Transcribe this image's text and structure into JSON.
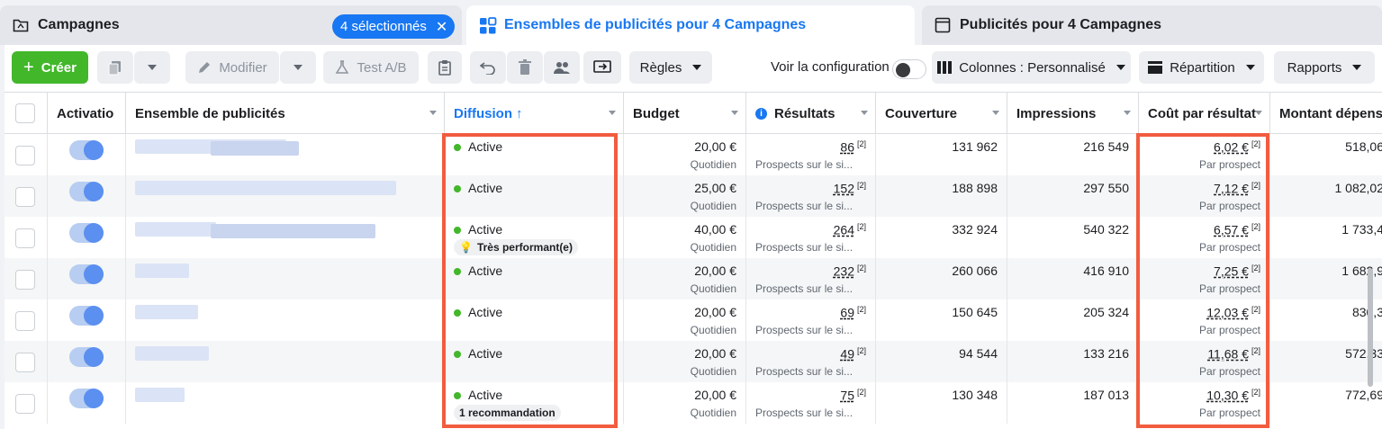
{
  "tabs": {
    "campaigns": "Campagnes",
    "selected_badge": "4 sélectionnés",
    "adsets": "Ensembles de publicités pour 4 Campagnes",
    "ads": "Publicités pour 4 Campagnes"
  },
  "toolbar": {
    "create": "Créer",
    "modify": "Modifier",
    "abtest": "Test A/B",
    "rules": "Règles",
    "view_config": "Voir la configuration",
    "columns": "Colonnes : Personnalisé",
    "breakdown": "Répartition",
    "reports": "Rapports"
  },
  "columns": {
    "activation": "Activatio",
    "adset": "Ensemble de publicités",
    "delivery": "Diffusion",
    "budget": "Budget",
    "results": "Résultats",
    "reach": "Couverture",
    "impressions": "Impressions",
    "cost": "Coût par résultat",
    "spent": "Montant dépensé"
  },
  "rows": [
    {
      "status": "Active",
      "badge": "",
      "budget": "20,00 €",
      "budget_sub": "Quotidien",
      "results": "86",
      "results_sub": "Prospects sur le si...",
      "reach": "131 962",
      "impressions": "216 549",
      "cost": "6,02 €",
      "cost_sub": "Par prospect",
      "spent": "518,06"
    },
    {
      "status": "Active",
      "badge": "",
      "budget": "25,00 €",
      "budget_sub": "Quotidien",
      "results": "152",
      "results_sub": "Prospects sur le si...",
      "reach": "188 898",
      "impressions": "297 550",
      "cost": "7,12 €",
      "cost_sub": "Par prospect",
      "spent": "1 082,02"
    },
    {
      "status": "Active",
      "badge": "Très performant(e)",
      "budget": "40,00 €",
      "budget_sub": "Quotidien",
      "results": "264",
      "results_sub": "Prospects sur le si...",
      "reach": "332 924",
      "impressions": "540 322",
      "cost": "6,57 €",
      "cost_sub": "Par prospect",
      "spent": "1 733,4"
    },
    {
      "status": "Active",
      "badge": "",
      "budget": "20,00 €",
      "budget_sub": "Quotidien",
      "results": "232",
      "results_sub": "Prospects sur le si...",
      "reach": "260 066",
      "impressions": "416 910",
      "cost": "7,25 €",
      "cost_sub": "Par prospect",
      "spent": "1 682,9"
    },
    {
      "status": "Active",
      "badge": "",
      "budget": "20,00 €",
      "budget_sub": "Quotidien",
      "results": "69",
      "results_sub": "Prospects sur le si...",
      "reach": "150 645",
      "impressions": "205 324",
      "cost": "12,03 €",
      "cost_sub": "Par prospect",
      "spent": "830,3"
    },
    {
      "status": "Active",
      "badge": "",
      "budget": "20,00 €",
      "budget_sub": "Quotidien",
      "results": "49",
      "results_sub": "Prospects sur le si...",
      "reach": "94 544",
      "impressions": "133 216",
      "cost": "11,68 €",
      "cost_sub": "Par prospect",
      "spent": "572,33"
    },
    {
      "status": "Active",
      "badge": "1 recommandation",
      "budget": "20,00 €",
      "budget_sub": "Quotidien",
      "results": "75",
      "results_sub": "Prospects sur le si...",
      "reach": "130 348",
      "impressions": "187 013",
      "cost": "10,30 €",
      "cost_sub": "Par prospect",
      "spent": "772,69"
    }
  ],
  "result_footnote": "[2]",
  "colors": {
    "accent": "#1877f2",
    "green": "#42b72a",
    "highlight": "#f25c3f"
  }
}
